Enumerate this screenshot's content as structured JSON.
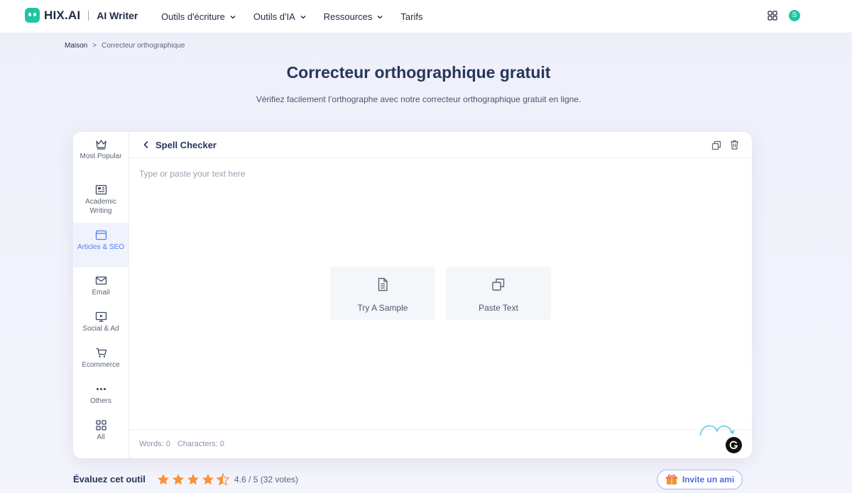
{
  "brand": {
    "name": "HIX.AI",
    "product": "AI Writer",
    "accent": "#21c4a0"
  },
  "nav": {
    "items": [
      {
        "label": "Outils d'écriture",
        "dropdown": true
      },
      {
        "label": "Outils d'IA",
        "dropdown": true
      },
      {
        "label": "Ressources",
        "dropdown": true
      },
      {
        "label": "Tarifs",
        "dropdown": false
      }
    ],
    "apps_icon": "grid-icon",
    "avatar_initial": "S"
  },
  "breadcrumb": {
    "home": "Maison",
    "separator": ">",
    "current": "Correcteur orthographique"
  },
  "header": {
    "title": "Correcteur orthographique gratuit",
    "subtitle": "Vérifiez facilement l’orthographe avec notre correcteur orthographique gratuit en ligne."
  },
  "sidebar": {
    "items": [
      {
        "label": "Most Popular",
        "icon": "crown-icon",
        "active": false
      },
      {
        "label": "Academic Writing",
        "icon": "newspaper-icon",
        "active": false
      },
      {
        "label": "Articles & SEO",
        "icon": "browser-window-icon",
        "active": true
      },
      {
        "label": "Email",
        "icon": "mail-icon",
        "active": false
      },
      {
        "label": "Social & Ad",
        "icon": "presentation-icon",
        "active": false
      },
      {
        "label": "Ecommerce",
        "icon": "cart-icon",
        "active": false
      },
      {
        "label": "Others",
        "icon": "more-dots-icon",
        "active": false
      },
      {
        "label": "All",
        "icon": "grid-icon",
        "active": false
      }
    ]
  },
  "editor": {
    "tool_title": "Spell Checker",
    "placeholder": "Type or paste your text here",
    "try_sample_label": "Try A Sample",
    "paste_text_label": "Paste Text",
    "words_label": "Words: 0",
    "characters_label": "Characters: 0"
  },
  "rating": {
    "label": "Évaluez cet outil",
    "value": 4.6,
    "text": "4.6 / 5 (32 votes)",
    "star_color": "#f6923b"
  },
  "invite": {
    "label": "Invite un ami"
  }
}
